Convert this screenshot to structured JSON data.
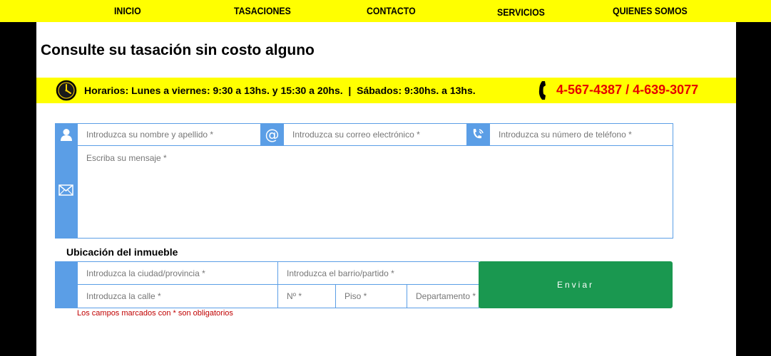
{
  "nav": {
    "items": [
      "INICIO",
      "TASACIONES",
      "CONTACTO",
      "SERVICIOS",
      "QUIENES SOMOS"
    ]
  },
  "page": {
    "title": "Consulte su tasación sin costo alguno"
  },
  "hours_bar": {
    "hours": "Horarios: Lunes a viernes: 9:30 a 13hs. y 15:30 a 20hs.  |  Sábados: 9:30hs. a 13hs.",
    "phones": "4-567-4387 / 4-639-3077",
    "clock_icon": "clock-icon",
    "phone_icon": "phone-icon"
  },
  "contact_form": {
    "name_placeholder": "Introduzca su nombre y apellido *",
    "email_placeholder": "Introduzca su correo electrónico *",
    "phone_placeholder": "Introduzca su número de teléfono *",
    "message_placeholder": "Escriba su mensaje *",
    "icons": [
      "user-icon",
      "at-sign-icon",
      "phone-volume-icon",
      "envelope-icon"
    ]
  },
  "location": {
    "section_title": "Ubicación del inmueble",
    "city_placeholder": "Introduzca la ciudad/provincia *",
    "neighborhood_placeholder": "Introduzca el barrio/partido *",
    "street_placeholder": "Introduzca la calle *",
    "number_placeholder": "Nº *",
    "floor_placeholder": "Piso *",
    "apartment_placeholder": "Departamento *"
  },
  "send_button": "Enviar",
  "required_note": "Los campos marcados con * son obligatorios",
  "colors": {
    "accent_yellow": "#ffff00",
    "form_blue": "#5b9ee6",
    "send_green": "#1a9850",
    "phone_red": "#e60000",
    "note_red": "#c00000"
  }
}
